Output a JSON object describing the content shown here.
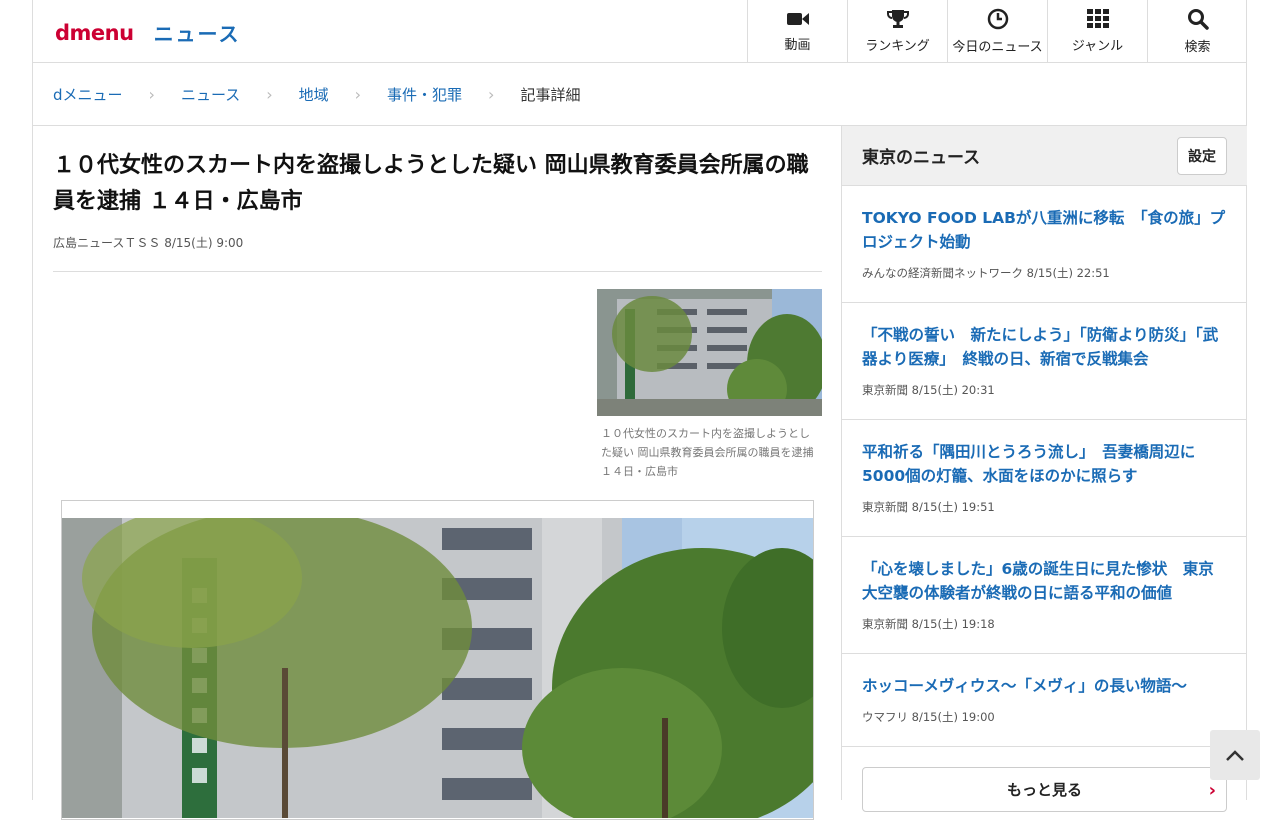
{
  "header": {
    "logo_d": "dmenu",
    "logo_news": "ニュース",
    "nav": [
      {
        "label": "動画",
        "icon": "video-camera-icon"
      },
      {
        "label": "ランキング",
        "icon": "trophy-icon"
      },
      {
        "label": "今日のニュース",
        "icon": "clock-icon"
      },
      {
        "label": "ジャンル",
        "icon": "grid-icon"
      },
      {
        "label": "検索",
        "icon": "search-icon"
      }
    ]
  },
  "breadcrumb": [
    "dメニュー",
    "ニュース",
    "地域",
    "事件・犯罪",
    "記事詳細"
  ],
  "article": {
    "title": "１０代女性のスカート内を盗撮しようとした疑い 岡山県教育委員会所属の職員を逮捕 １４日・広島市",
    "source": "広島ニュースＴＳＳ",
    "date": "8/15(土) 9:00",
    "thumb_caption": "１０代女性のスカート内を盗撮しようとした疑い 岡山県教育委員会所属の職員を逮捕 １４日・広島市"
  },
  "sidebar": {
    "title": "東京のニュース",
    "settings_label": "設定",
    "items": [
      {
        "title": "TOKYO FOOD LABが八重洲に移転　「食の旅」プロジェクト始動",
        "source": "みんなの経済新聞ネットワーク",
        "date": "8/15(土) 22:51"
      },
      {
        "title": "「不戦の誓い　新たにしよう」「防衛より防災」「武器より医療」　終戦の日、新宿で反戦集会",
        "source": "東京新聞",
        "date": "8/15(土) 20:31"
      },
      {
        "title": "平和祈る「隅田川とうろう流し」　吾妻橋周辺に5000個の灯籠、水面をほのかに照らす",
        "source": "東京新聞",
        "date": "8/15(土) 19:51"
      },
      {
        "title": "「心を壊しました」6歳の誕生日に見た惨状　東京大空襲の体験者が終戦の日に語る平和の価値",
        "source": "東京新聞",
        "date": "8/15(土) 19:18"
      },
      {
        "title": "ホッコーメヴィウス〜「メヴィ」の長い物語〜",
        "source": "ウマフリ",
        "date": "8/15(土) 19:00"
      }
    ],
    "more_label": "もっと見る"
  },
  "colors": {
    "brand_red": "#cc0033",
    "link_blue": "#1a6bb5"
  }
}
